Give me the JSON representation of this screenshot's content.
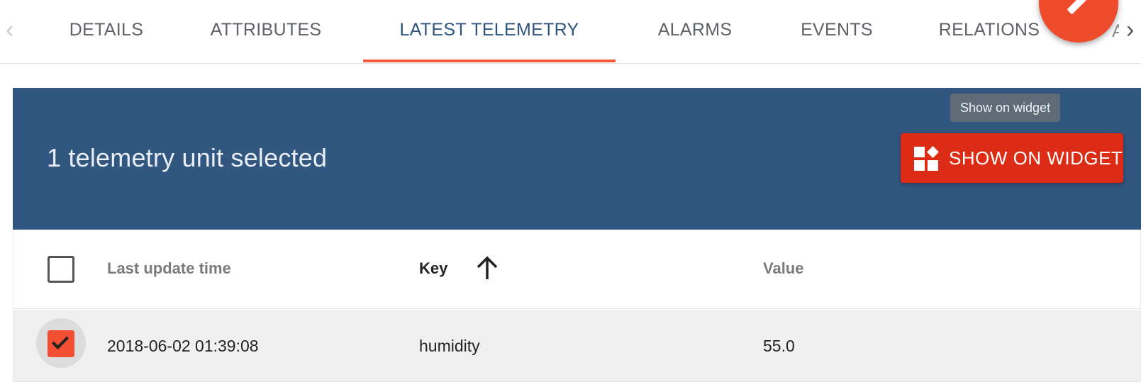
{
  "tabs": {
    "items": [
      {
        "label": "DETAILS"
      },
      {
        "label": "ATTRIBUTES"
      },
      {
        "label": "LATEST TELEMETRY"
      },
      {
        "label": "ALARMS"
      },
      {
        "label": "EVENTS"
      },
      {
        "label": "RELATIONS"
      }
    ],
    "active_index": 2,
    "prev_glyph": "‹",
    "next_glyph": "›",
    "partial_label": "A"
  },
  "selection": {
    "text": "1 telemetry unit selected"
  },
  "tooltip": {
    "text": "Show on widget"
  },
  "toolbar": {
    "show_on_widget_label": "SHOW ON WIDGET",
    "icon": "widgets-icon"
  },
  "table": {
    "columns": {
      "last_update": "Last update time",
      "key": "Key",
      "value": "Value"
    },
    "sort": {
      "column": "key",
      "direction": "ascending"
    },
    "rows": [
      {
        "last_update": "2018-06-02 01:39:08",
        "key": "humidity",
        "value": "55.0",
        "selected": true
      }
    ]
  },
  "colors": {
    "accent": "#f35b3b",
    "header_panel": "#31567f",
    "button": "#dd2c15",
    "active_tab_text": "#305680"
  }
}
